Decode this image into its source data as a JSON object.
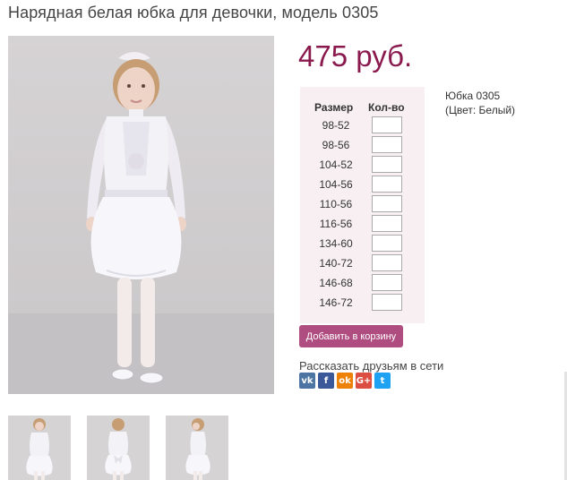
{
  "product": {
    "title": "Нарядная белая юбка для девочки, модель 0305",
    "price": "475 руб.",
    "info_line1": "Юбка 0305",
    "info_line2": "(Цвет: Белый)"
  },
  "size_table": {
    "header_size": "Размер",
    "header_qty": "Кол-во",
    "sizes": [
      "98-52",
      "98-56",
      "104-52",
      "104-56",
      "110-56",
      "116-56",
      "134-60",
      "140-72",
      "146-68",
      "146-72"
    ]
  },
  "cart": {
    "add_label": "Добавить в корзину"
  },
  "share": {
    "label": "Рассказать друзьям в сети",
    "networks": [
      {
        "icon": "vk-icon",
        "glyph": "vk",
        "color": "#4c75a3"
      },
      {
        "icon": "facebook-icon",
        "glyph": "f",
        "color": "#3b5998"
      },
      {
        "icon": "odnoklassniki-icon",
        "glyph": "ok",
        "color": "#ee8208"
      },
      {
        "icon": "google-plus-icon",
        "glyph": "G+",
        "color": "#dc4e41"
      },
      {
        "icon": "twitter-icon",
        "glyph": "t",
        "color": "#1da1f2"
      }
    ]
  },
  "colors": {
    "accent": "#8a1a4e",
    "button": "#b04d80",
    "panel": "#f7eff2"
  }
}
